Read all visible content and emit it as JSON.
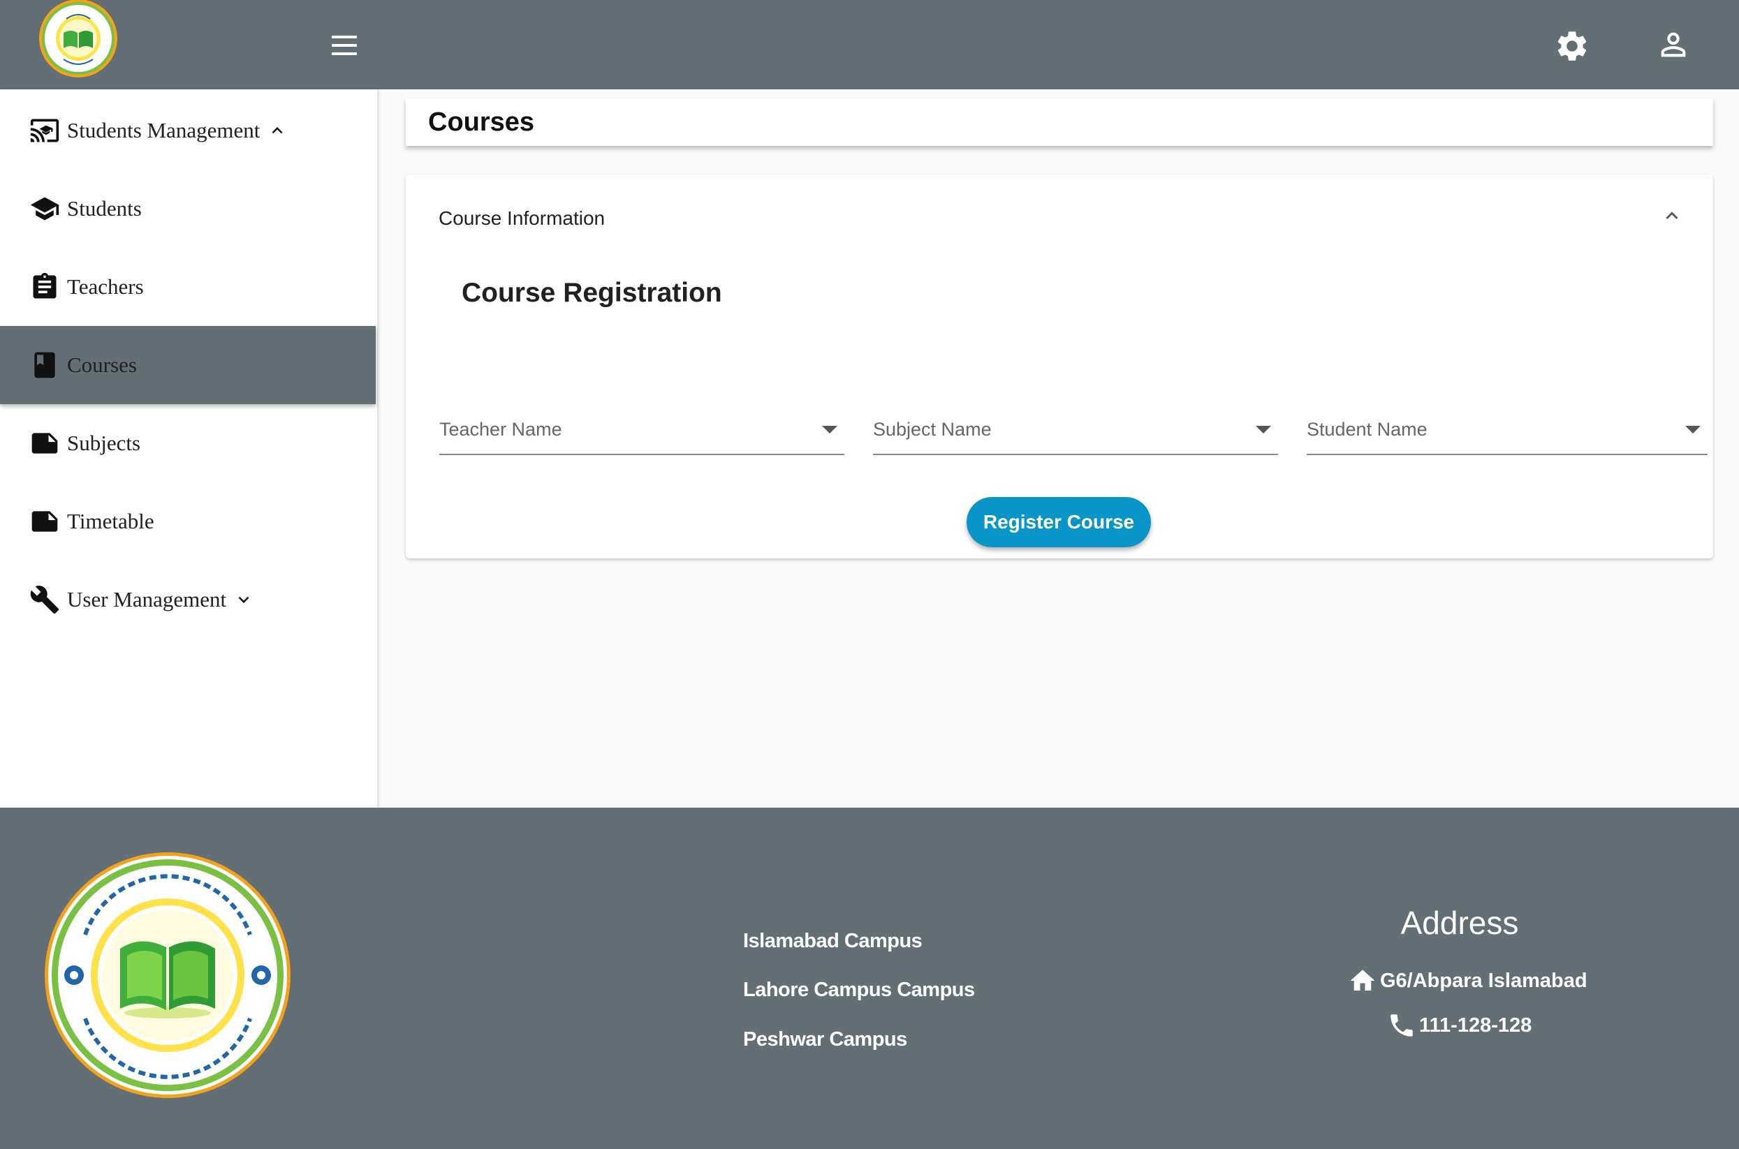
{
  "colors": {
    "header_bg": "#636e75",
    "footer_bg": "#636e75",
    "active_item_bg": "#636e75",
    "primary_button": "#0a95c9",
    "page_bg": "#fafafa"
  },
  "topbar": {
    "logo": "school-seal-logo",
    "icons": [
      "menu-icon",
      "settings-icon",
      "account-icon"
    ]
  },
  "sidebar": {
    "items": [
      {
        "label": "Students Management",
        "icon": "cast-school-icon",
        "expandable": true,
        "expanded": true
      },
      {
        "label": "Students",
        "icon": "graduation-cap-icon"
      },
      {
        "label": "Teachers",
        "icon": "clipboard-icon"
      },
      {
        "label": "Courses",
        "icon": "book-icon",
        "active": true
      },
      {
        "label": "Subjects",
        "icon": "note-icon"
      },
      {
        "label": "Timetable",
        "icon": "note-icon"
      },
      {
        "label": "User Management",
        "icon": "wrench-icon",
        "expandable": true,
        "expanded": false
      }
    ]
  },
  "main": {
    "page_title": "Courses",
    "panel": {
      "header": "Course Information",
      "form_title": "Course Registration",
      "fields": [
        {
          "placeholder": "Teacher Name",
          "value": ""
        },
        {
          "placeholder": "Subject Name",
          "value": ""
        },
        {
          "placeholder": "Student Name",
          "value": ""
        }
      ],
      "submit_label": "Register Course"
    }
  },
  "footer": {
    "campuses": [
      "Islamabad Campus",
      "Lahore Campus Campus",
      "Peshwar Campus"
    ],
    "address_title": "Address",
    "address": "G6/Abpara Islamabad",
    "phone": "111-128-128"
  }
}
